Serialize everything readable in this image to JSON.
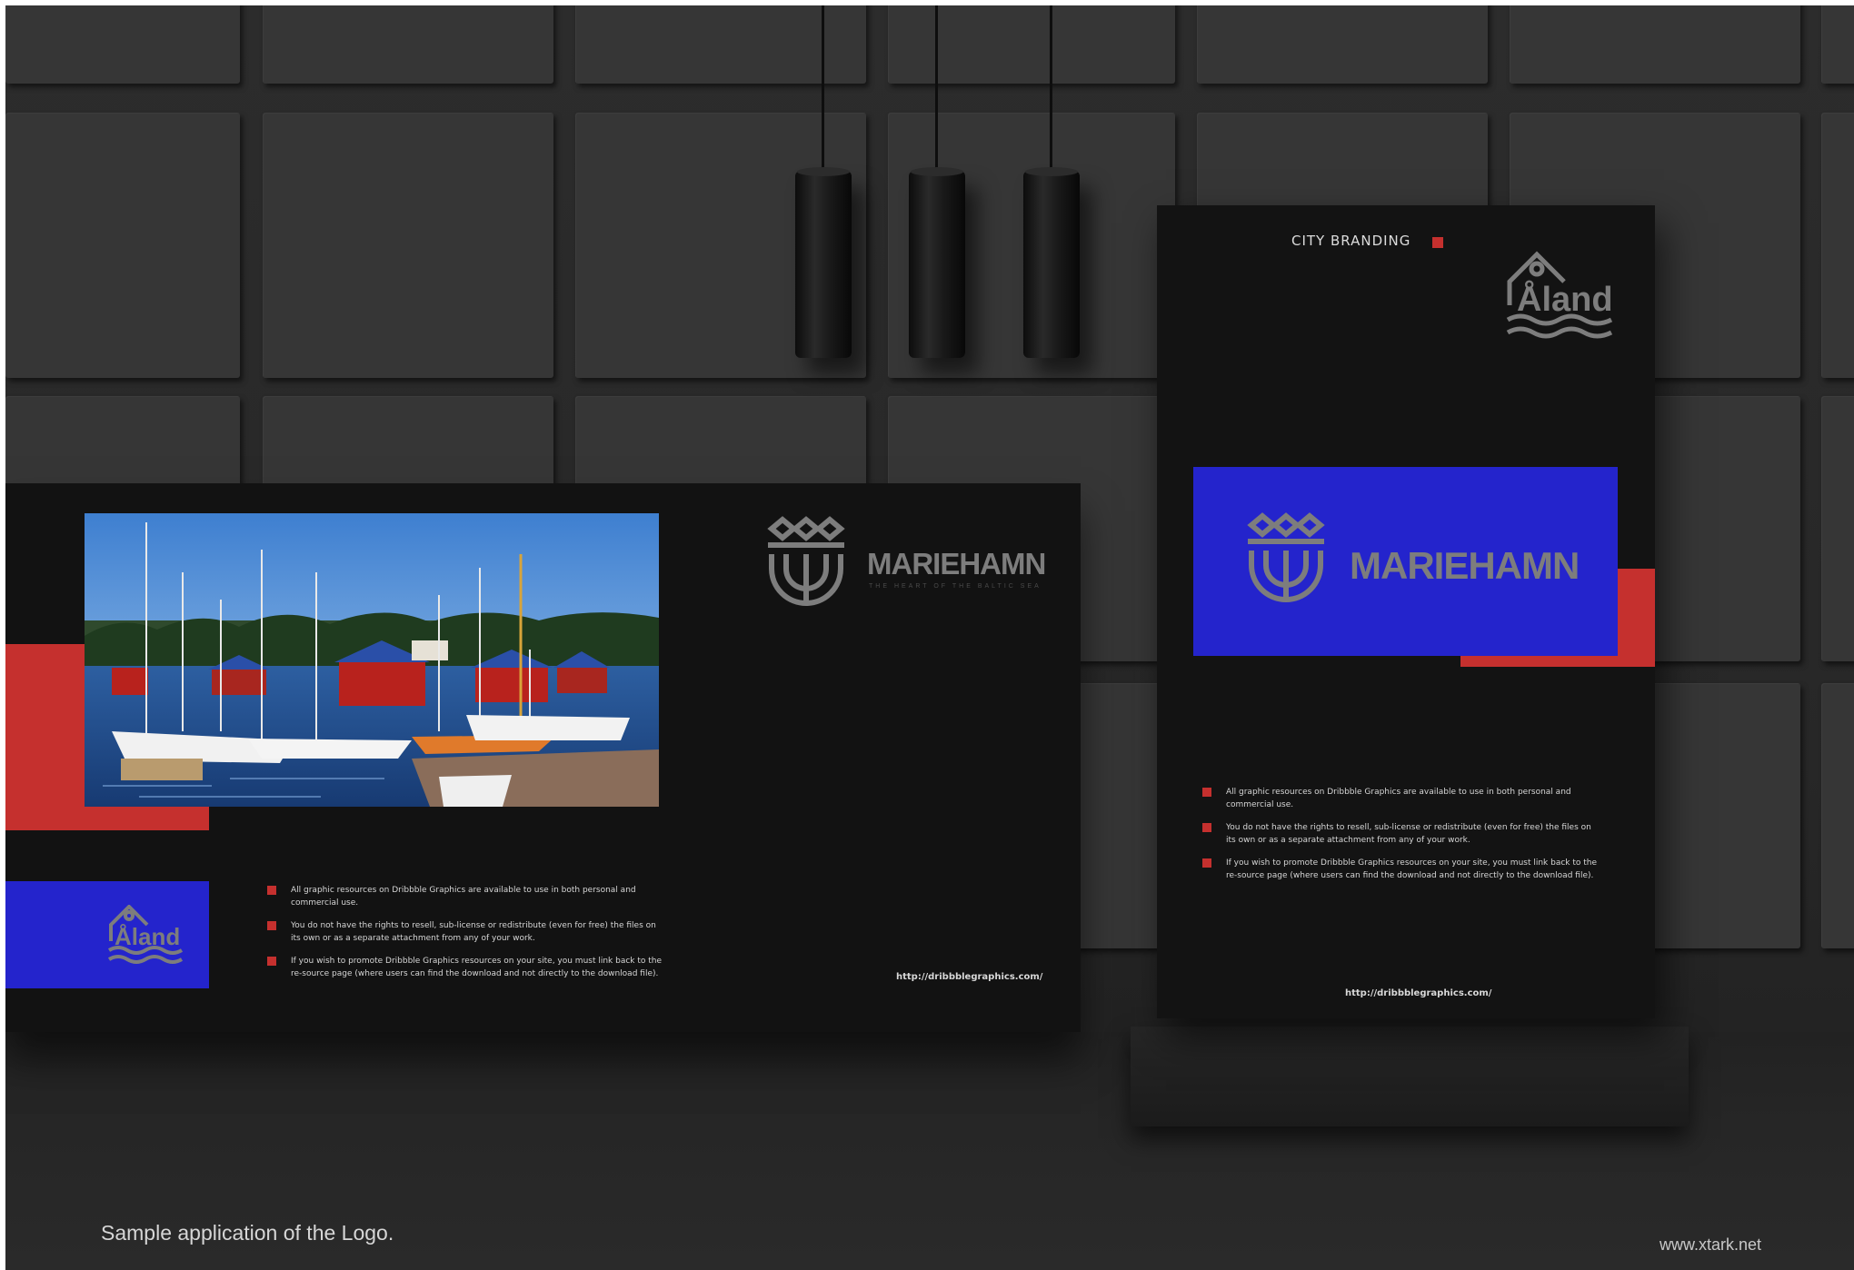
{
  "board": {
    "brand": "MARIEHAMN",
    "tagline": "THE HEART OF THE BALTIC SEA",
    "aland_logo": "Åland",
    "bullets": [
      "All graphic resources on Dribbble Graphics are available to use in both personal and commercial use.",
      "You do not have the rights to resell, sub-license or redistribute (even for free) the files on its own or as a separate attachment from any of your work.",
      "If you wish to promote Dribbble Graphics resources on your site, you must link back to the re-source page  (where users can find the download and not directly to the download file)."
    ],
    "url": "http://dribbblegraphics.com/",
    "photo": "harbor-marina-photo"
  },
  "standee": {
    "header": "CITY BRANDING",
    "aland_logo": "Åland",
    "brand": "MARIEHAMN",
    "bullets": [
      "All graphic resources on Dribbble Graphics are available to use in both personal and commercial use.",
      "You do not have the rights to resell, sub-license or redistribute (even for free) the files on its own or as a separate attachment from any of your work.",
      "If you wish to promote Dribbble Graphics resources on your site, you must link back to the re-source page  (where users can find the download and not directly to the download file)."
    ],
    "url": "http://dribbblegraphics.com/"
  },
  "caption": "Sample application of the Logo.",
  "site": "www.xtark.net",
  "colors": {
    "accent_red": "#c5302e",
    "brand_blue": "#2424cc",
    "logo_grey": "#7d7d7d"
  }
}
